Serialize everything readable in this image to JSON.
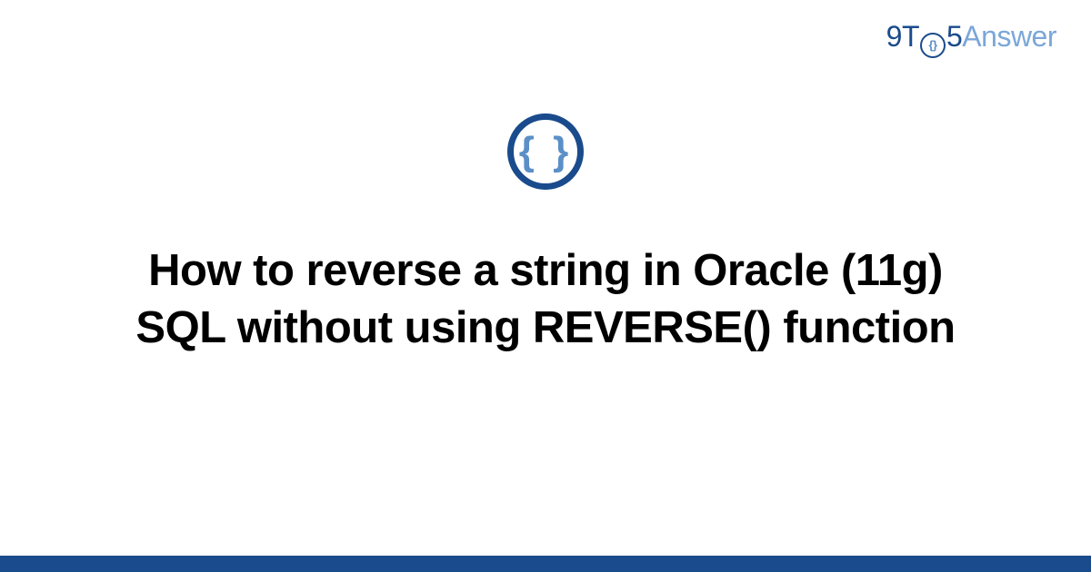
{
  "logo": {
    "part1": "9T",
    "circle_inner": "{}",
    "part2": "5",
    "part3": "Answer"
  },
  "icon": {
    "braces": "{ }",
    "name": "code-braces-icon"
  },
  "title": "How to reverse a string in Oracle (11g) SQL without using REVERSE() function",
  "colors": {
    "primary": "#1a4b8c",
    "accent": "#5b8fc7",
    "accent_light": "#7ba7d9"
  }
}
